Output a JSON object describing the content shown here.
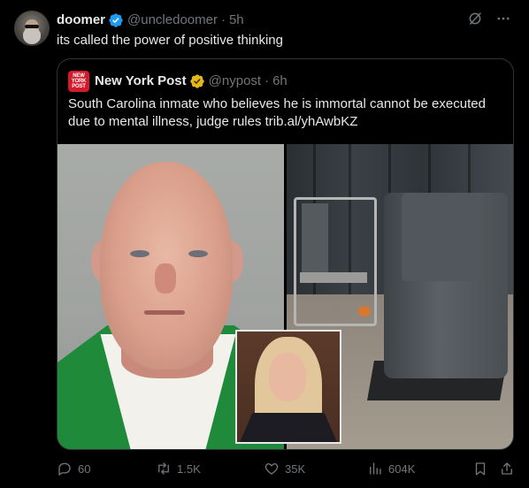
{
  "tweet": {
    "author": {
      "display_name": "doomer",
      "handle": "@uncledoomer",
      "time": "5h"
    },
    "text": "its called the power of positive thinking"
  },
  "quoted": {
    "author": {
      "display_name": "New York Post",
      "handle": "@nypost",
      "time": "6h",
      "logo_text": "NEW YORK POST"
    },
    "text": "South Carolina inmate who believes he is immortal cannot be executed due to mental illness, judge rules trib.al/yhAwbKZ"
  },
  "actions": {
    "replies": "60",
    "reposts": "1.5K",
    "likes": "35K",
    "views": "604K"
  },
  "icons": {
    "verified_author": "blue-verified-badge-icon",
    "verified_quoted": "gold-verified-badge-icon",
    "grok": "grok-icon",
    "more": "more-icon"
  },
  "colors": {
    "background": "#000000",
    "text": "#e7e9ea",
    "muted": "#71767b",
    "border": "#2f3336",
    "blue_badge": "#1d9bf0",
    "gold_badge": "#e2b719",
    "nyp_red": "#d41b2c"
  }
}
